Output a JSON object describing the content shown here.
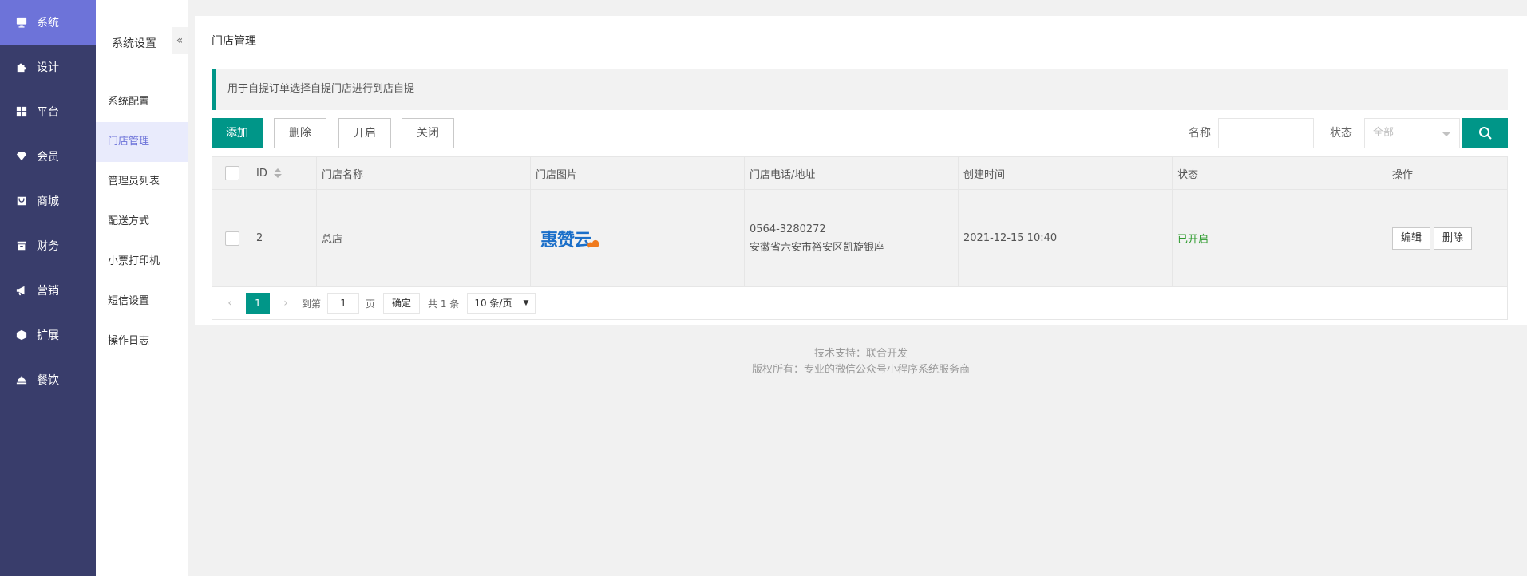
{
  "nav": {
    "items": [
      {
        "label": "系统",
        "icon": "monitor-icon",
        "active": true
      },
      {
        "label": "设计",
        "icon": "puzzle-icon"
      },
      {
        "label": "平台",
        "icon": "grid-icon"
      },
      {
        "label": "会员",
        "icon": "diamond-icon"
      },
      {
        "label": "商城",
        "icon": "shop-icon"
      },
      {
        "label": "财务",
        "icon": "finance-icon"
      },
      {
        "label": "营销",
        "icon": "megaphone-icon"
      },
      {
        "label": "扩展",
        "icon": "cube-icon"
      },
      {
        "label": "餐饮",
        "icon": "cloche-icon"
      }
    ]
  },
  "subnav": {
    "title": "系统设置",
    "collapse": "«",
    "items": [
      {
        "label": "系统配置"
      },
      {
        "label": "门店管理",
        "active": true
      },
      {
        "label": "管理员列表"
      },
      {
        "label": "配送方式"
      },
      {
        "label": "小票打印机"
      },
      {
        "label": "短信设置"
      },
      {
        "label": "操作日志"
      }
    ]
  },
  "page": {
    "title": "门店管理",
    "tip": "用于自提订单选择自提门店进行到店自提"
  },
  "toolbar": {
    "add": "添加",
    "delete": "删除",
    "open": "开启",
    "close": "关闭",
    "name_label": "名称",
    "name_value": "",
    "status_label": "状态",
    "status_value": "全部"
  },
  "table": {
    "headers": {
      "id": "ID",
      "name": "门店名称",
      "image": "门店图片",
      "contact": "门店电话/地址",
      "created": "创建时间",
      "status": "状态",
      "actions": "操作"
    },
    "rows": [
      {
        "id": "2",
        "name": "总店",
        "image_text": "惠赞云",
        "phone": "0564-3280272",
        "address": "安徽省六安市裕安区凯旋银座",
        "created": "2021-12-15 10:40",
        "status": "已开启",
        "edit": "编辑",
        "delete": "删除"
      }
    ]
  },
  "pager": {
    "prev": "‹",
    "current": "1",
    "next": "›",
    "goto_label": "到第",
    "goto_value": "1",
    "page_unit": "页",
    "confirm": "确定",
    "total": "共 1 条",
    "page_size": "10 条/页"
  },
  "footer": {
    "line1": "技术支持：联合开发",
    "line2": "版权所有：专业的微信公众号小程序系统服务商"
  },
  "colors": {
    "nav_bg": "#393d6b",
    "nav_active": "#6d73d9",
    "accent": "#009688",
    "status_on": "#2f9b2f"
  }
}
